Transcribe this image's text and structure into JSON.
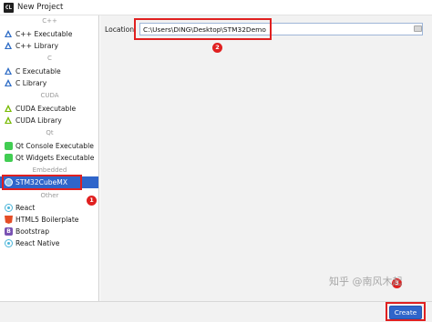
{
  "window": {
    "title": "New Project",
    "app_icon_text": "CL"
  },
  "sidebar": {
    "groups": [
      {
        "header": "C++",
        "items": [
          {
            "label": "C++ Executable",
            "icon": "cpp-triangle-icon"
          },
          {
            "label": "C++ Library",
            "icon": "cpp-triangle-icon"
          }
        ]
      },
      {
        "header": "C",
        "items": [
          {
            "label": "C Executable",
            "icon": "c-triangle-icon"
          },
          {
            "label": "C Library",
            "icon": "c-triangle-icon"
          }
        ]
      },
      {
        "header": "CUDA",
        "items": [
          {
            "label": "CUDA Executable",
            "icon": "cuda-triangle-icon"
          },
          {
            "label": "CUDA Library",
            "icon": "cuda-triangle-icon"
          }
        ]
      },
      {
        "header": "Qt",
        "items": [
          {
            "label": "Qt Console Executable",
            "icon": "qt-icon"
          },
          {
            "label": "Qt Widgets Executable",
            "icon": "qt-icon"
          }
        ]
      },
      {
        "header": "Embedded",
        "items": [
          {
            "label": "STM32CubeMX",
            "icon": "stm32-cube-icon",
            "selected": true
          }
        ]
      },
      {
        "header": "Other",
        "items": [
          {
            "label": "React",
            "icon": "react-icon"
          },
          {
            "label": "HTML5 Boilerplate",
            "icon": "html5-icon"
          },
          {
            "label": "Bootstrap",
            "icon": "bootstrap-icon"
          },
          {
            "label": "React Native",
            "icon": "react-icon"
          }
        ]
      }
    ]
  },
  "main": {
    "location_label": "Location:",
    "location_value": "C:\\Users\\DING\\Desktop\\STM32Demo"
  },
  "footer": {
    "create_label": "Create"
  },
  "annotations": {
    "badge_1": "1",
    "badge_2": "2",
    "badge_3": "3",
    "highlight_color": "#e02020"
  },
  "watermark": "知乎 @南风木起",
  "colors": {
    "selection": "#2f65ca",
    "accent": "#2f65ca"
  },
  "bootstrap_icon_text": "B"
}
